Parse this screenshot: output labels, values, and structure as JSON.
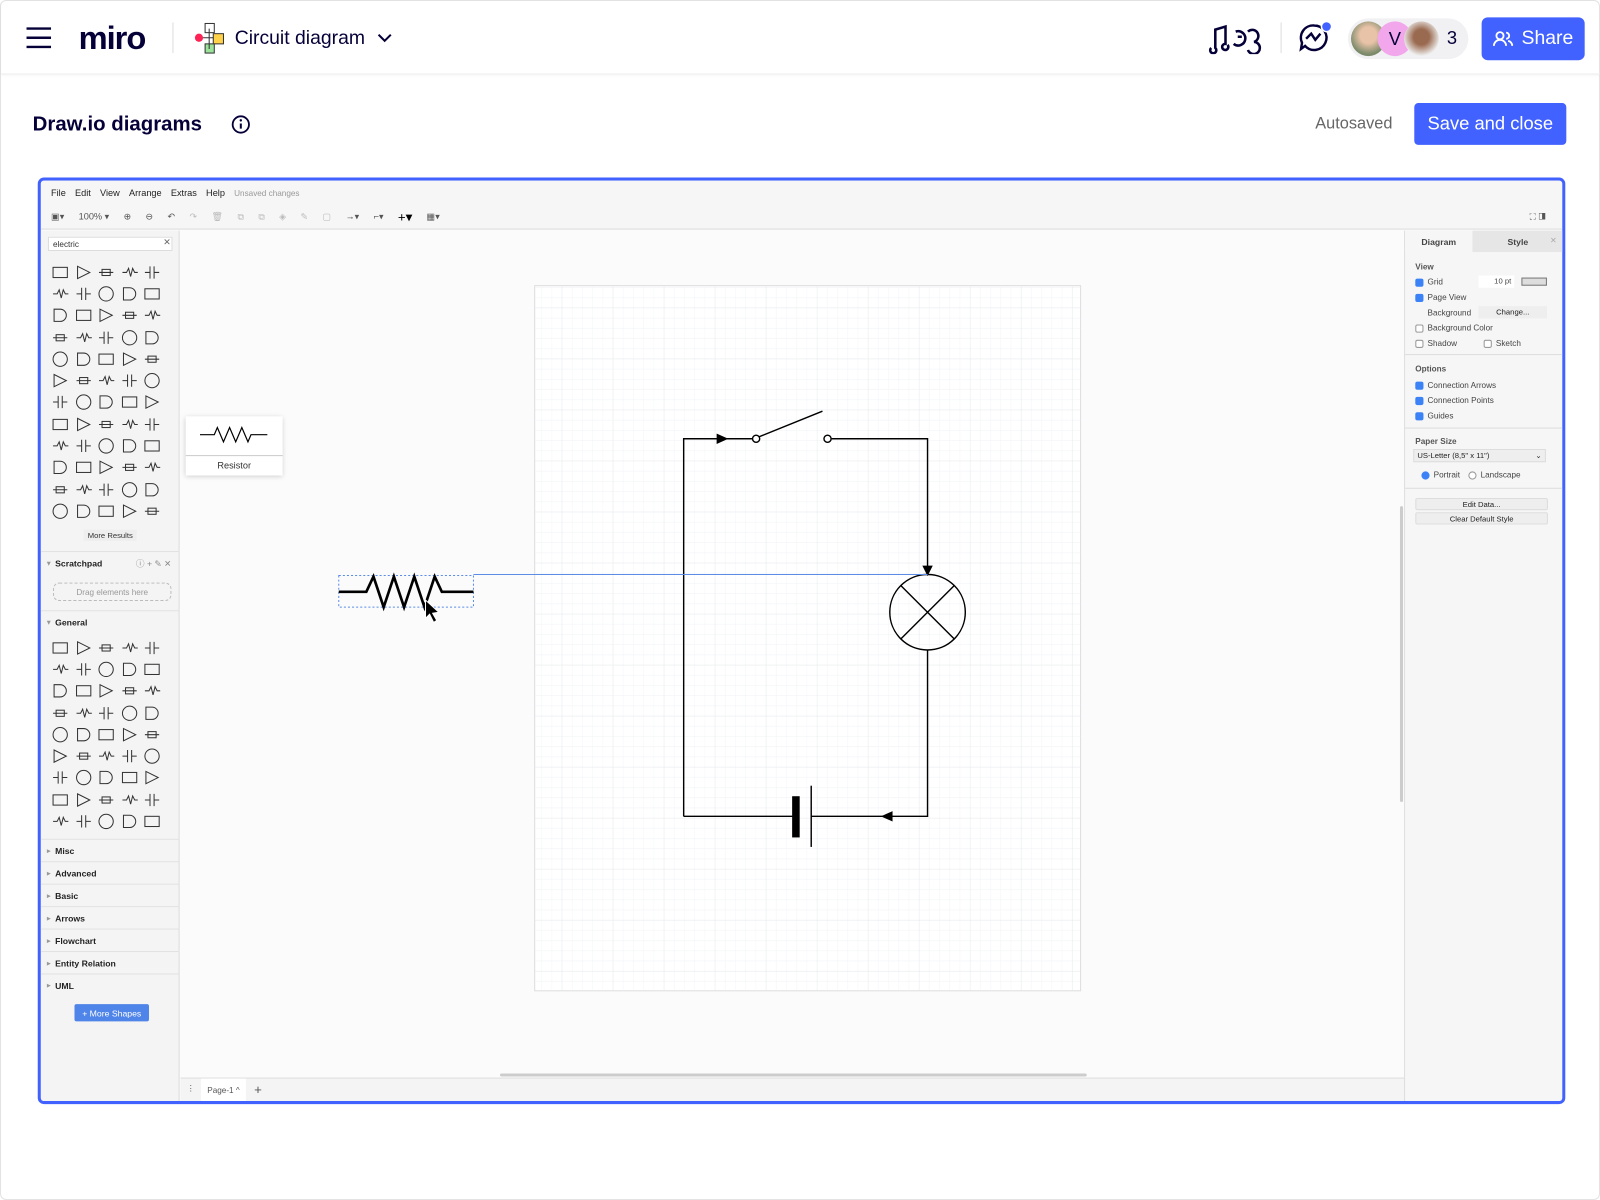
{
  "topbar": {
    "logo": "miro",
    "board_title": "Circuit diagram",
    "collaborator_count": "3",
    "avatar_initial": "V",
    "share_label": "Share",
    "accent": "#4262ff"
  },
  "header": {
    "title": "Draw.io diagrams",
    "status": "Autosaved",
    "save_label": "Save and close"
  },
  "drawio": {
    "menu": [
      "File",
      "Edit",
      "View",
      "Arrange",
      "Extras",
      "Help"
    ],
    "unsaved": "Unsaved changes",
    "zoom": "100%",
    "search_value": "electric",
    "more_results": "More Results",
    "tooltip": "Resistor",
    "scratchpad": {
      "title": "Scratchpad",
      "placeholder": "Drag elements here"
    },
    "general": "General",
    "sections": [
      "Misc",
      "Advanced",
      "Basic",
      "Arrows",
      "Flowchart",
      "Entity Relation",
      "UML"
    ],
    "more_shapes": "+ More Shapes",
    "page_tab": "Page-1",
    "right": {
      "tabs": [
        "Diagram",
        "Style"
      ],
      "view": "View",
      "grid": "Grid",
      "grid_size": "10 pt",
      "page_view": "Page View",
      "background": "Background",
      "change": "Change...",
      "background_color": "Background Color",
      "shadow": "Shadow",
      "sketch": "Sketch",
      "options": "Options",
      "connection_arrows": "Connection Arrows",
      "connection_points": "Connection Points",
      "guides": "Guides",
      "paper_size": "Paper Size",
      "paper_value": "US-Letter (8,5\" x 11\")",
      "portrait": "Portrait",
      "landscape": "Landscape",
      "edit_data": "Edit Data...",
      "clear_style": "Clear Default Style"
    }
  }
}
